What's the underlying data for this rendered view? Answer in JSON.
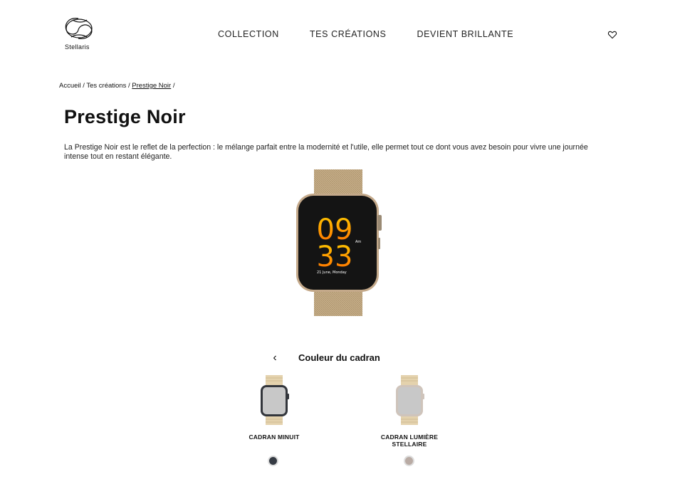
{
  "header": {
    "logo_text": "Stellaris",
    "nav": [
      "COLLECTION",
      "TES CRÉATIONS",
      "DEVIENT BRILLANTE"
    ],
    "favorites_icon": "heart-icon"
  },
  "breadcrumb": {
    "items": [
      "Accueil",
      "Tes créations",
      "Prestige Noir"
    ],
    "separator": " / "
  },
  "product": {
    "title": "Prestige Noir",
    "description": "La Prestige Noir est le reflet de la perfection : le mélange parfait entre la modernité et l'utile, elle permet tout ce dont vous avez besoin pour vivre une journée intense tout en restant élégante.",
    "watch_face": {
      "hour": "09",
      "minute": "33",
      "ampm": "Am",
      "date": "21 June, Monday"
    }
  },
  "dial_selector": {
    "title": "Couleur du cadran",
    "options": [
      {
        "label": "CADRAN MINUIT",
        "color": "#363b44"
      },
      {
        "label": "CADRAN LUMIÈRE STELLAIRE",
        "color": "#b9aba4"
      }
    ]
  }
}
